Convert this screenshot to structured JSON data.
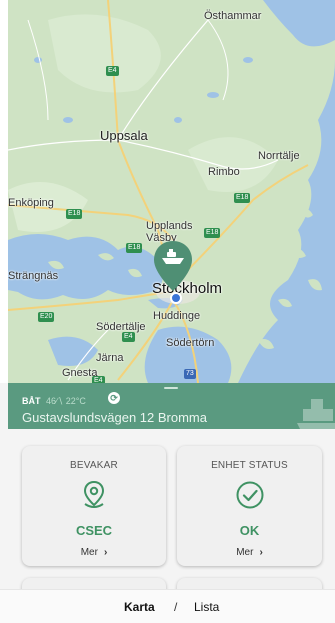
{
  "map": {
    "labels": {
      "osthammar": "Östhammar",
      "uppsala": "Uppsala",
      "rimbo": "Rimbo",
      "norrtalje": "Norrtälje",
      "enkoping": "Enköping",
      "upplands_vasby": "Upplands\nVäsby",
      "strangnas": "Strängnäs",
      "stockholm": "Stockholm",
      "huddinge": "Huddinge",
      "sodertalje": "Södertälje",
      "sodertorn": "Södertörn",
      "jarna": "Järna",
      "gnesta": "Gnesta"
    },
    "roads": {
      "e4_top": "E4",
      "e18_left": "E18",
      "e18_mid": "E18",
      "e18_right": "E18",
      "e18_right2": "E18",
      "e20": "E20",
      "e4_mid": "E4",
      "e4_low": "E4",
      "r73": "73"
    },
    "pin_icon": "boat-icon",
    "colors": {
      "land": "#cfe3c4",
      "water": "#9fc2e6",
      "pin": "#4f8f74"
    }
  },
  "banner": {
    "type": "BÅT",
    "meta": "46∕∖ 22°C",
    "address": "Gustavslundsvägen 12 Bromma",
    "sync_icon": "sync-icon",
    "color": "#5a9a80"
  },
  "cards": [
    {
      "title": "BEVAKAR",
      "icon": "location-pin-icon",
      "value": "CSEC",
      "more": "Mer",
      "chevron": "›"
    },
    {
      "title": "ENHET STATUS",
      "icon": "check-circle-icon",
      "value": "OK",
      "more": "Mer",
      "chevron": "›"
    }
  ],
  "tabbar": {
    "karta": "Karta",
    "separator": "/",
    "lista": "Lista"
  },
  "accent": "#3f9263"
}
